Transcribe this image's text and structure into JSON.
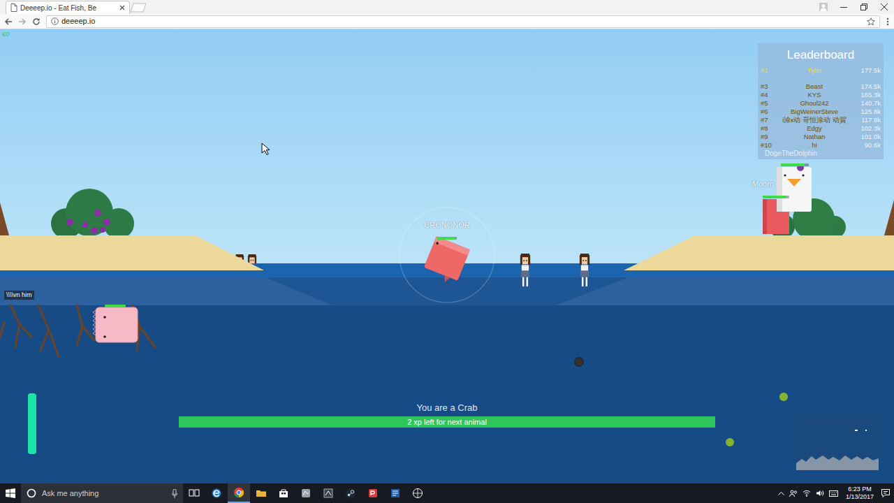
{
  "browser": {
    "tab": {
      "title": "Deeeep.io - Eat Fish, Be",
      "selected": true
    },
    "address": "deeeep.io"
  },
  "game": {
    "coins": "€0",
    "chat_bubble": "\\\\\\\\vn him",
    "player": {
      "name": "CRONONOR",
      "health": 0.9
    },
    "creatures": [
      {
        "kind": "pinkfish",
        "health": 1.0
      },
      {
        "kind": "redfish",
        "name": "Moom",
        "health": 0.9
      },
      {
        "kind": "seagull",
        "health": 0.85
      }
    ],
    "leaderboard": {
      "title": "Leaderboard",
      "rows": [
        {
          "rank": "#1",
          "name": "Tyler",
          "score": "177.5k",
          "highlighted": true
        },
        {
          "rank": "#3",
          "name": "Beast",
          "score": "174.5k",
          "highlighted": false
        },
        {
          "rank": "#4",
          "name": "KYS",
          "score": "165.3k",
          "highlighted": false
        },
        {
          "rank": "#5",
          "name": "Ghoul242",
          "score": "140.7k",
          "highlighted": false
        },
        {
          "rank": "#6",
          "name": "BigWeinerSteve",
          "score": "125.8k",
          "highlighted": false
        },
        {
          "rank": "#7",
          "name": "i涂к动 哥恒涂动 动賀",
          "score": "117.9k",
          "highlighted": false
        },
        {
          "rank": "#8",
          "name": "Edgy",
          "score": "102.3k",
          "highlighted": false
        },
        {
          "rank": "#9",
          "name": "Nathan",
          "score": "101.0k",
          "highlighted": false
        },
        {
          "rank": "#10",
          "name": "hi",
          "score": "90.6k",
          "highlighted": false
        }
      ],
      "footer": "DogeTheDolphin"
    },
    "hud": {
      "status": "You are a Crab",
      "xp_text": "2 xp left for next animal",
      "xp_level": 1.0,
      "boost_level": 1.0
    }
  },
  "taskbar": {
    "search_placeholder": "Ask me anything",
    "time": "6:23 PM",
    "date": "1/13/2017"
  }
}
